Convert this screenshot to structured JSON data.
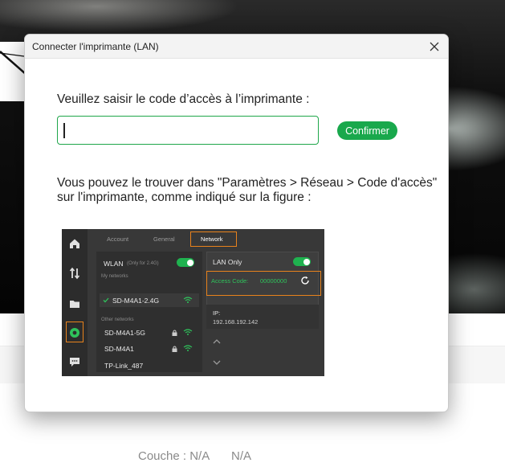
{
  "background": {
    "status_layer": "Couche : N/A",
    "status_value": "N/A"
  },
  "dialog": {
    "title": "Connecter l'imprimante (LAN)",
    "prompt": "Veuillez saisir le code d’accès à l’imprimante :",
    "input_value": "",
    "confirm_label": "Confirmer",
    "hint_line1": "Vous pouvez le trouver dans \"Paramètres > Réseau > Code d'accès\"",
    "hint_line2": "sur l'imprimante, comme indiqué sur la figure :",
    "accent_color": "#19a84c"
  },
  "figure": {
    "tabs": [
      "Account",
      "General",
      "Network"
    ],
    "active_tab": "Network",
    "wlan_label": "WLAN",
    "wlan_note": "(Only for 2.4G)",
    "my_networks_label": "My networks",
    "connected_network": "SD-M4A1-2.4G",
    "other_networks_label": "Other networks",
    "other_networks": [
      "SD-M4A1-5G",
      "SD-M4A1",
      "TP-Link_487"
    ],
    "lan_only_label": "LAN Only",
    "access_code_label": "Access Code:",
    "access_code_value": "00000000",
    "ip_label": "IP:",
    "ip_value": "192.168.192.142",
    "highlight_color": "#e8821c",
    "rail_icons": [
      "home-icon",
      "tune-icon",
      "folder-icon",
      "gear-icon",
      "chat-icon"
    ]
  }
}
